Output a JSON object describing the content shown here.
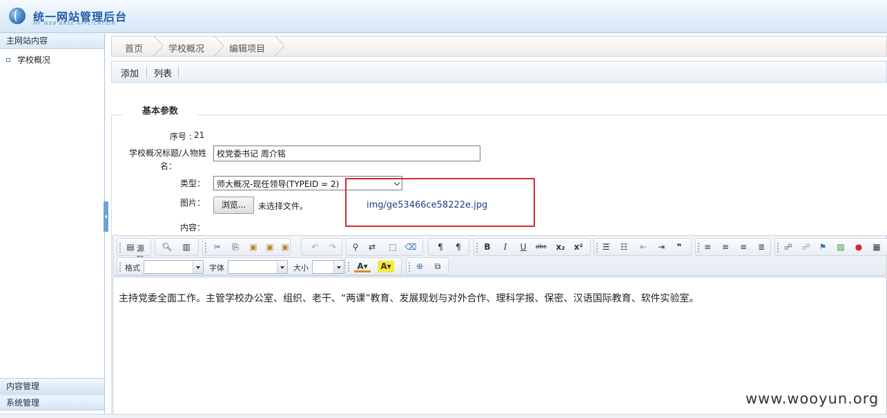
{
  "header": {
    "title": "统一网站管理后台",
    "subtitle": "MF WEB BASE APPLICATION"
  },
  "sidebar": {
    "section_title": "主网站内容",
    "items": [
      {
        "label": "学校概况"
      }
    ],
    "bottom_sections": [
      "内容管理",
      "系统管理"
    ]
  },
  "breadcrumb": [
    "首页",
    "学校概况",
    "编辑项目"
  ],
  "actions": {
    "add": "添加",
    "list": "列表"
  },
  "form": {
    "legend": "基本参数",
    "seq_label": "序号 :",
    "seq_value": "21",
    "title_label_1": "学校概况标题/人物姓",
    "title_label_2": "名：",
    "title_value": "校党委书记 周介铭",
    "type_label": "类型：",
    "type_value": "师大概况-现任领导(TYPEID = 2)",
    "image_label": "图片：",
    "browse_label": "浏览...",
    "no_file_text": "未选择文件。",
    "image_path": "img/ge53466ce58222e.jpg",
    "content_label": "内容："
  },
  "toolbar": {
    "source_label": "源码",
    "format_label": "格式",
    "font_label": "字体",
    "size_label": "大小"
  },
  "editor": {
    "content": "主持党委全面工作。主管学校办公室、组织、老干、“两课”教育、发展规划与对外合作、理科学报、保密、汉语国际教育、软件实验室。"
  },
  "watermark": "www.wooyun.org",
  "colors": {
    "highlight_box": "#d9262b",
    "accent": "#1f5ba8"
  }
}
